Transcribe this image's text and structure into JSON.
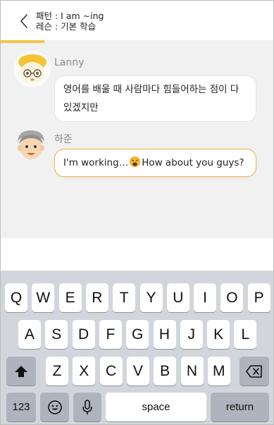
{
  "header": {
    "pattern": "패턴 : I am ~ing",
    "lesson": "레슨 : 기본 학습",
    "progress": 0.16
  },
  "chat": {
    "messages": [
      {
        "sender": "Lanny",
        "text": "영어를 배울 때 사람마다 힘들어하는 점이 다 있겠지만"
      },
      {
        "sender": "하준",
        "text_before": "I'm working…",
        "text_after": "How about you guys?",
        "emoji": "weary-face-emoji"
      }
    ]
  },
  "keyboard": {
    "row1": [
      "Q",
      "W",
      "E",
      "R",
      "T",
      "Y",
      "U",
      "I",
      "O",
      "P"
    ],
    "row2": [
      "A",
      "S",
      "D",
      "F",
      "G",
      "H",
      "J",
      "K",
      "L"
    ],
    "row3": [
      "Z",
      "X",
      "C",
      "V",
      "B",
      "N",
      "M"
    ],
    "numbers_label": "123",
    "space_label": "space",
    "return_label": "return",
    "icons": {
      "shift": "shift-arrow-icon",
      "backspace": "backspace-icon",
      "emoji": "emoji-icon",
      "mic": "microphone-icon"
    }
  },
  "colors": {
    "accent": "#f6c64a",
    "bubble_border": "#f2b733",
    "chat_bg": "#f1f1f1",
    "keyboard_bg": "#d2d5db"
  }
}
